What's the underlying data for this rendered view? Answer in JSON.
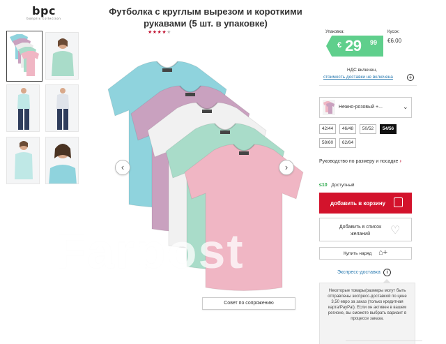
{
  "brand": {
    "logo": "bpc",
    "tagline": "bonprix collection"
  },
  "product": {
    "title": "Футболка с круглым вырезом и короткими рукавами (5 шт. в упаковке)",
    "rating": "4 of 5",
    "size_advice_label": "Совет по сопряжению",
    "watermark": "Farpost"
  },
  "thumbnails": [
    {
      "name": "pack-all-colors",
      "alt": "5 футболок"
    },
    {
      "name": "model-front-green",
      "alt": "модель"
    },
    {
      "name": "model-mint-full",
      "alt": "модель"
    },
    {
      "name": "model-navy-full",
      "alt": "модель"
    },
    {
      "name": "model-mint-half",
      "alt": "модель"
    },
    {
      "name": "model-blue-closeup",
      "alt": "модель"
    }
  ],
  "price": {
    "pack_label": "Упаковка:",
    "piece_label": "Кусок:",
    "piece_value": "€6.00",
    "currency": "€",
    "amount": "29",
    "cents": "99",
    "vat": "НДС включен,",
    "shipping_link": "стоимость доставки не включена",
    "tag_color": "#5fcf8c"
  },
  "color_select": {
    "value": "Нежно-розовый +..."
  },
  "sizes": [
    "42/44",
    "46/48",
    "50/52",
    "54/56",
    "58/60",
    "62/64"
  ],
  "selected_size": "54/56",
  "size_guide": "Руководство по размеру и посадке",
  "availability": {
    "code": "≤10",
    "label": "Доступный"
  },
  "buttons": {
    "add_to_cart": "добавить в корзину",
    "wishlist": "Добавить в список желаний",
    "buy_outfit": "Купить наряд",
    "accent": "#d3132c"
  },
  "express": {
    "label": "Экспресс-доставка",
    "tooltip": "Некоторые товары/размеры могут быть отправлены экспресс-доставкой по цене 3,50 евро за заказ (только кредитная карта/PayPal). Если он активен в вашем регионе, вы сможете выбрать вариант в процессе заказа."
  },
  "shirts": {
    "colors": [
      "#8fd3dd",
      "#c9a1bf",
      "#f1f1f1",
      "#a9dcc9",
      "#f0b6c4"
    ]
  }
}
